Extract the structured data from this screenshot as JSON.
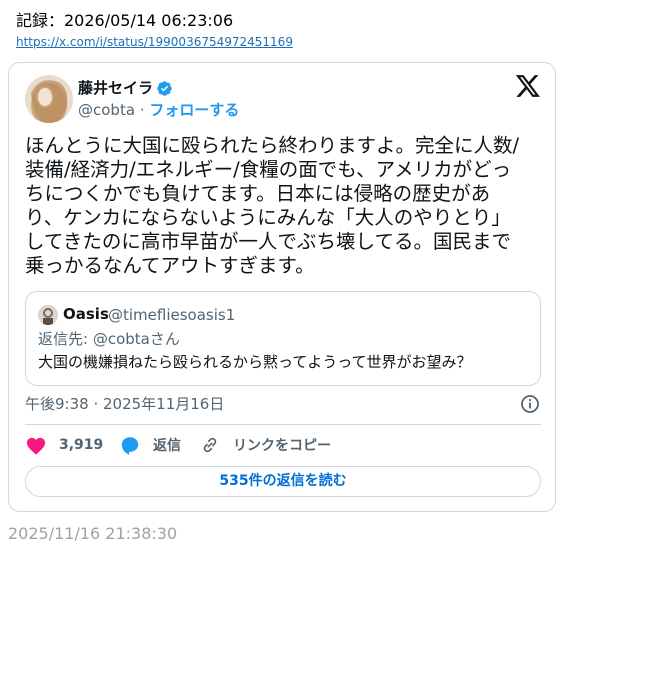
{
  "record": {
    "label": "記録：2026/05/14 06:23:06",
    "url": "https://x.com/i/status/1990036754972451169"
  },
  "tweet": {
    "author_name": "藤井セイラ",
    "author_handle": "@cobta",
    "separator": "·",
    "follow_label": "フォローする",
    "text_lines": [
      "ほんとうに大国に殴られたら終わりますよ。完全に人数/",
      "装備/経済力/エネルギー/食糧の面でも、アメリカがどっ",
      "ちにつくかでも負けてます。日本には侵略の歴史があ",
      "り、ケンカにならないようにみんな「大人のやりとり」",
      "してきたのに高市早苗が一人でぶち壊してる。国民まで",
      "乗っかるなんてアウトすぎます。"
    ],
    "timestamp": "午後9:38 · 2025年11月16日",
    "likes": "3,919",
    "reply_label": "返信",
    "copy_link_label": "リンクをコピー",
    "read_replies_label": "535件の返信を読む"
  },
  "quote": {
    "author_name": "Oasis",
    "author_handle": "@timefliesoasis1",
    "reply_to": "返信先: @cobtaさん",
    "text": "大国の機嫌損ねたら殴られるから黙ってようって世界がお望み？"
  },
  "footer": {
    "timestamp": "2025/11/16 21:38:30"
  },
  "colors": {
    "accent": "#1d9bf0",
    "like": "#f91880",
    "link": "#006fd6",
    "muted": "#536471",
    "border": "#cfd9de"
  },
  "icons": [
    "verified-badge-icon",
    "x-logo-icon",
    "info-icon",
    "heart-icon",
    "reply-icon",
    "link-icon"
  ]
}
